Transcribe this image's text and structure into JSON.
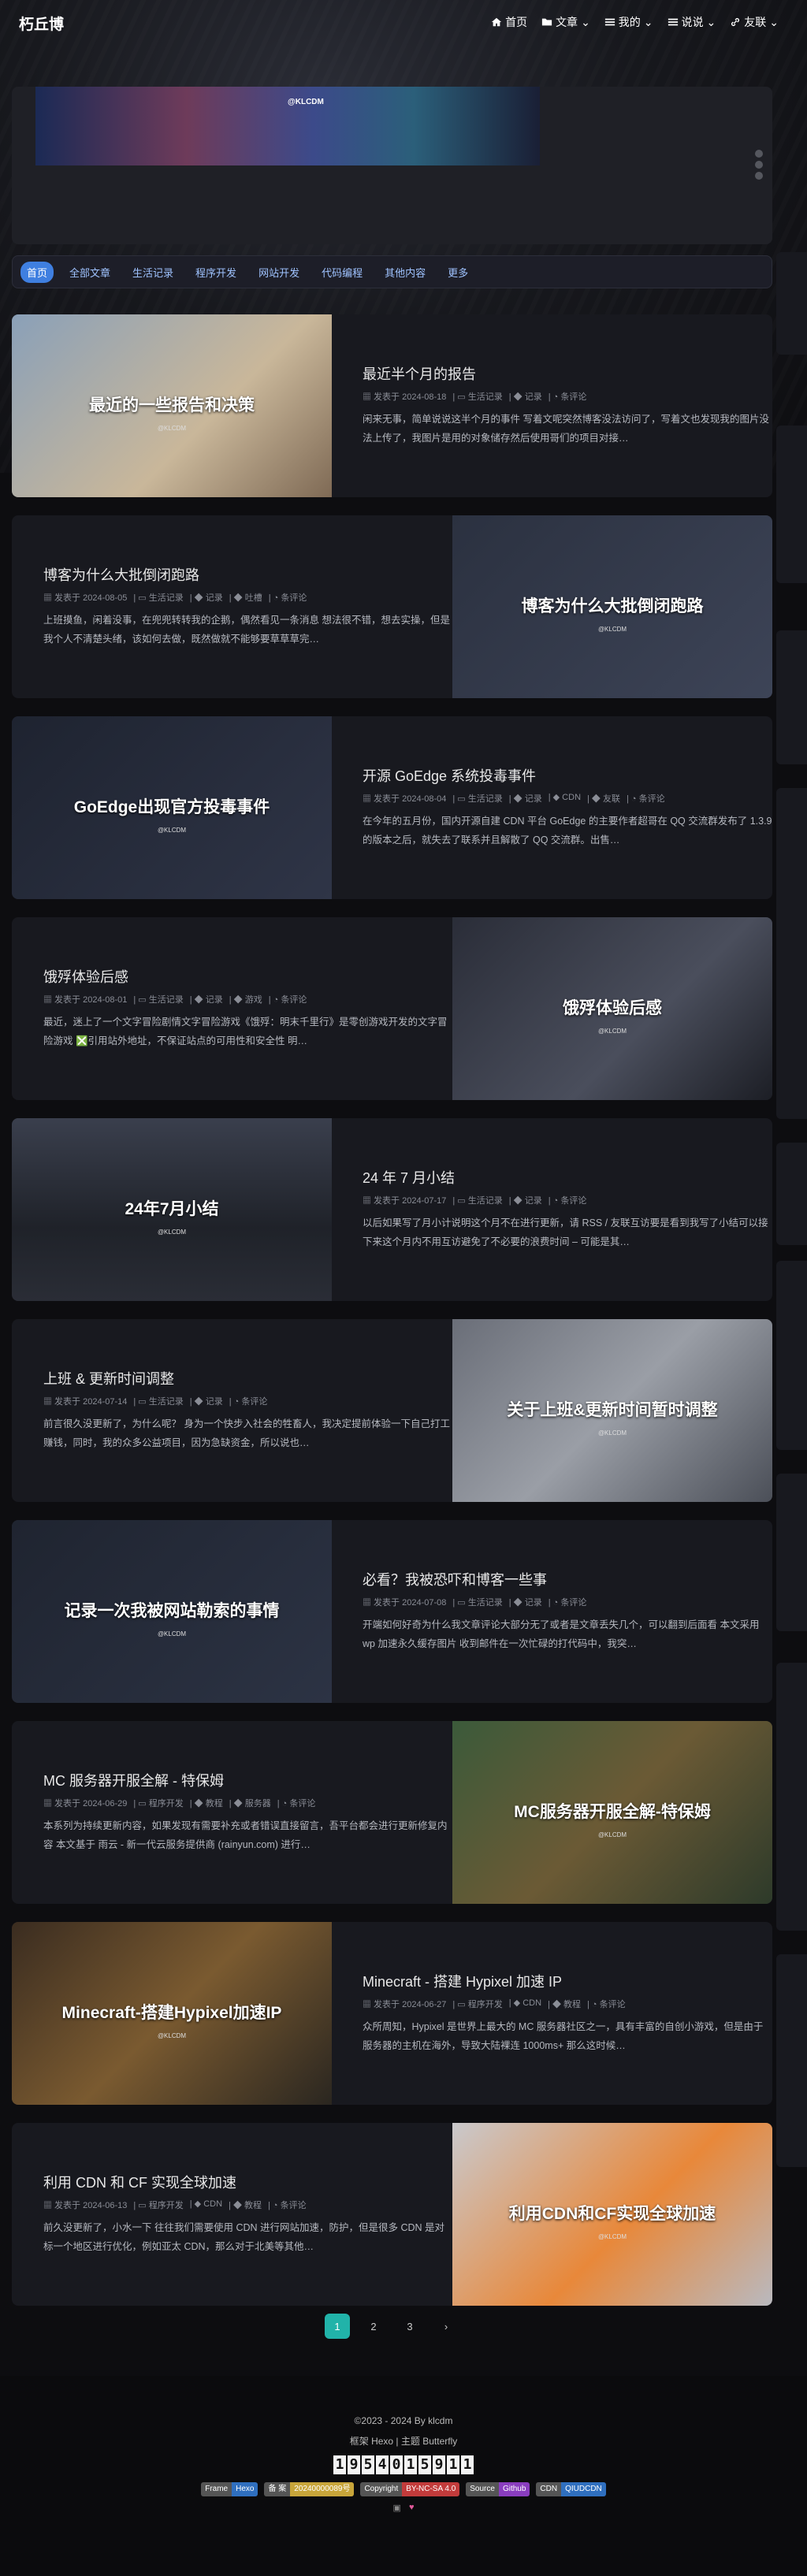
{
  "site": {
    "brand": "朽丘博"
  },
  "nav": {
    "items": [
      {
        "label": "首页",
        "icon": "home-icon"
      },
      {
        "label": "文章",
        "icon": "folder-icon"
      },
      {
        "label": "我的",
        "icon": "list-icon"
      },
      {
        "label": "说说",
        "icon": "list-icon"
      },
      {
        "label": "友联",
        "icon": "link-icon"
      }
    ]
  },
  "banner": {
    "logo": "@KLCDM"
  },
  "categories": [
    "首页",
    "全部文章",
    "生活记录",
    "程序开发",
    "网站开发",
    "代码编程",
    "其他内容",
    "更多"
  ],
  "meta_labels": {
    "published": "发表于",
    "comments": "条评论"
  },
  "posts": [
    {
      "title": "最近半个月的报告",
      "thumb": "最近的一些报告和决策",
      "date": "2024-08-18",
      "cat": "生活记录",
      "tags": [
        "记录"
      ],
      "excerpt": "闲来无事，简单说说这半个月的事件 写着文呢突然博客没法访问了，写着文也发现我的图片没法上传了，我图片是用的对象储存然后使用哥们的项目对接…",
      "thumb_bg": "linear-gradient(135deg,#8aa0b8,#c9b79a 60%,#7f6a55)",
      "wm": "@KLCDM"
    },
    {
      "title": "博客为什么大批倒闭跑路",
      "thumb": "博客为什么大批倒闭跑路",
      "date": "2024-08-05",
      "cat": "生活记录",
      "tags": [
        "记录",
        "吐槽"
      ],
      "excerpt": "上班摸鱼，闲着没事，在兜兜转转我的企鹅，偶然看见一条消息 想法很不错，想去实操，但是我个人不清楚头绪，该如何去做，既然做就不能够要草草草完…",
      "thumb_bg": "linear-gradient(135deg,#2b3140,#3d4457)",
      "wm": "@KLCDM"
    },
    {
      "title": "开源 GoEdge 系统投毒事件",
      "thumb": "GoEdge出现官方投毒事件",
      "date": "2024-08-04",
      "cat": "生活记录",
      "tags": [
        "记录",
        "CDN",
        "友联"
      ],
      "excerpt": "在今年的五月份，国内开源自建 CDN 平台 GoEdge 的主要作者超哥在 QQ 交流群发布了 1.3.9 的版本之后，就失去了联系并且解散了 QQ 交流群。出售…",
      "thumb_bg": "linear-gradient(135deg,#1e2330,#2f3547)",
      "wm": "@KLCDM"
    },
    {
      "title": "饿殍体验后感",
      "thumb": "饿殍体验后感",
      "date": "2024-08-01",
      "cat": "生活记录",
      "tags": [
        "记录",
        "游戏"
      ],
      "excerpt": "最近，迷上了一个文字冒险剧情文字冒险游戏《饿殍：明末千里行》是零创游戏开发的文字冒险游戏 ❎引用站外地址，不保证站点的可用性和安全性 明…",
      "thumb_bg": "linear-gradient(135deg,#2a2d38,#4a4e5c 60%,#1c1e25)",
      "wm": "@KLCDM"
    },
    {
      "title": "24 年 7 月小结",
      "thumb": "24年7月小结",
      "date": "2024-07-17",
      "cat": "生活记录",
      "tags": [
        "记录"
      ],
      "excerpt": "以后如果写了月小计说明这个月不在进行更新，请 RSS / 友联互访要是看到我写了小结可以接下来这个月内不用互访避免了不必要的浪费时间 – 可能是其…",
      "thumb_bg": "linear-gradient(180deg,#3a3f4d,#1f2229 60%,#2a2d36)",
      "wm": "@KLCDM"
    },
    {
      "title": "上班 & 更新时间调整",
      "thumb": "关于上班&更新时间暂时调整",
      "date": "2024-07-14",
      "cat": "生活记录",
      "tags": [
        "记录"
      ],
      "excerpt": "前言很久没更新了，为什么呢？ 身为一个快步入社会的牲畜人，我决定提前体验一下自己打工赚钱，同时，我的众多公益项目，因为急缺资金，所以说也…",
      "thumb_bg": "linear-gradient(135deg,#6a6e78,#9a9ea6 50%,#4b4f58)",
      "wm": "@KLCDM"
    },
    {
      "title": "必看？我被恐吓和博客一些事",
      "thumb": "记录一次我被网站勒索的事情",
      "date": "2024-07-08",
      "cat": "生活记录",
      "tags": [
        "记录"
      ],
      "excerpt": "开端如何好奇为什么我文章评论大部分无了或者是文章丢失几个，可以翻到后面看 本文采用 wp 加速永久缓存图片 收到邮件在一次忙碌的打代码中，我突…",
      "thumb_bg": "linear-gradient(135deg,#1f2430,#2c3344)",
      "wm": "@KLCDM"
    },
    {
      "title": "MC 服务器开服全解 - 特保姆",
      "thumb": "MC服务器开服全解-特保姆",
      "date": "2024-06-29",
      "cat": "程序开发",
      "tags": [
        "教程",
        "服务器"
      ],
      "excerpt": "本系列为持续更新内容，如果发现有需要补充或者错误直接留言，吾平台都会进行更新修复内容 本文基于 雨云 - 新一代云服务提供商 (rainyun.com) 进行…",
      "thumb_bg": "linear-gradient(135deg,#3b5a3a,#6b5a35 50%,#2d3a2a)",
      "wm": "@KLCDM"
    },
    {
      "title": "Minecraft - 搭建 Hypixel 加速 IP",
      "thumb": "Minecraft-搭建Hypixel加速IP",
      "date": "2024-06-27",
      "cat": "程序开发",
      "tags": [
        "CDN",
        "教程"
      ],
      "excerpt": "众所周知，Hypixel 是世界上最大的 MC 服务器社区之一，具有丰富的自创小游戏，但是由于服务器的主机在海外，导致大陆裸连 1000ms+ 那么这时候…",
      "thumb_bg": "linear-gradient(135deg,#3a2c20,#7a5a30 50%,#2a2620)",
      "wm": "@KLCDM"
    },
    {
      "title": "利用 CDN 和 CF 实现全球加速",
      "thumb": "利用CDN和CF实现全球加速",
      "date": "2024-06-13",
      "cat": "程序开发",
      "tags": [
        "CDN",
        "教程"
      ],
      "excerpt": "前久没更新了，小水一下 往往我们需要使用 CDN 进行网站加速，防护，但是很多 CDN 是对标一个地区进行优化，例如亚太 CDN，那么对于北美等其他…",
      "thumb_bg": "linear-gradient(135deg,#c9c9cd,#e8883a 55%,#b9b9bf)",
      "wm": "@KLCDM"
    }
  ],
  "pager": [
    "1",
    "2",
    "3"
  ],
  "footer": {
    "copyright": "©2023 - 2024 By klcdm",
    "framework": "框架 Hexo | 主题 Butterfly",
    "counter": [
      "1",
      "9",
      "5",
      "4",
      "0",
      "1",
      "5",
      "9",
      "1",
      "1"
    ],
    "badges": [
      {
        "k": "Frame",
        "v": "Hexo",
        "color": "#2f6fbf"
      },
      {
        "k": "备 案",
        "v": "20240000089号",
        "color": "#c8a53a"
      },
      {
        "k": "Copyright",
        "v": "BY-NC-SA 4.0",
        "color": "#c23b3b"
      },
      {
        "k": "Source",
        "v": "Github",
        "color": "#8a3dbf"
      },
      {
        "k": "CDN",
        "v": "QIUDCDN",
        "color": "#2f6fbf"
      }
    ]
  },
  "colors": {
    "accent": "#3f7fe0",
    "pager_active": "#21b3a9"
  }
}
